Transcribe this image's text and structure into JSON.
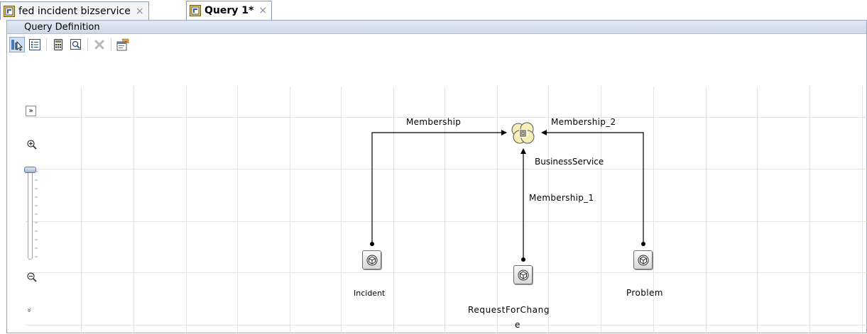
{
  "tabs": [
    {
      "label": "fed incident bizservice",
      "active": false,
      "close_glyph": "×"
    },
    {
      "label": "Query 1*",
      "active": true,
      "close_glyph": "×"
    }
  ],
  "panel": {
    "title": "Query Definition"
  },
  "toolbar": {
    "buttons": [
      {
        "name": "select-mode-icon",
        "pressed": true
      },
      {
        "name": "list-view-icon"
      },
      {
        "name": "calculator-icon"
      },
      {
        "name": "preview-icon"
      },
      {
        "name": "delete-icon",
        "disabled": true
      },
      {
        "name": "properties-icon"
      }
    ]
  },
  "canvas_controls": {
    "expand_glyph": "»",
    "collapse_glyph": "»"
  },
  "diagram": {
    "nodes": {
      "business_service": {
        "label": "BusinessService",
        "icon": "business-service-icon"
      },
      "incident": {
        "label": "Incident",
        "icon": "ci-cube-icon"
      },
      "request_for_change": {
        "label_line1": "RequestForChang",
        "label_line2": "e",
        "icon": "ci-cube-icon"
      },
      "problem": {
        "label": "Problem",
        "icon": "ci-cube-icon"
      }
    },
    "edges": {
      "membership": {
        "label": "Membership"
      },
      "membership_1": {
        "label": "Membership_1"
      },
      "membership_2": {
        "label": "Membership_2"
      }
    }
  },
  "colors": {
    "panel_header": "#cfd8e6",
    "grid": "#e2e2e2",
    "edge": "#000000"
  }
}
